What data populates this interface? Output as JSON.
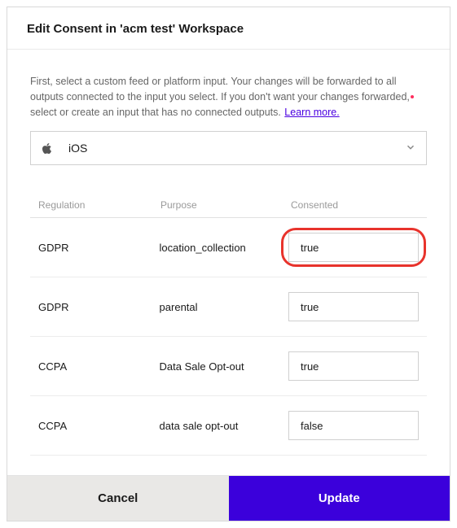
{
  "header": {
    "title": "Edit Consent in 'acm test' Workspace"
  },
  "body": {
    "instruction": "First, select a custom feed or platform input. Your changes will be forwarded to all outputs connected to the input you select. If you don't want your changes forwarded, select or create an input that has no connected outputs.",
    "learn_more": "Learn more.",
    "platform_select": {
      "icon": "apple-icon",
      "value": "iOS"
    },
    "table": {
      "headers": {
        "regulation": "Regulation",
        "purpose": "Purpose",
        "consented": "Consented"
      },
      "rows": [
        {
          "regulation": "GDPR",
          "purpose": "location_collection",
          "consented": "true",
          "highlighted": true
        },
        {
          "regulation": "GDPR",
          "purpose": "parental",
          "consented": "true",
          "highlighted": false
        },
        {
          "regulation": "CCPA",
          "purpose": "Data Sale Opt-out",
          "consented": "true",
          "highlighted": false
        },
        {
          "regulation": "CCPA",
          "purpose": "data sale opt-out",
          "consented": "false",
          "highlighted": false
        }
      ]
    }
  },
  "footer": {
    "cancel": "Cancel",
    "update": "Update"
  }
}
